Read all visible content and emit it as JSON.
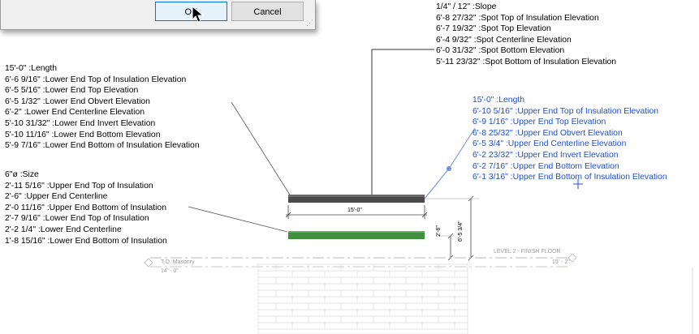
{
  "dialog": {
    "ok_label": "OK",
    "cancel_label": "Cancel"
  },
  "top_right_labels": [
    "1/4\" / 12\" :Slope",
    "6'-8 27/32\" :Spot Top of Insulation Elevation",
    "6'-7 19/32\" :Spot Top Elevation",
    "6'-4 9/32\" :Spot Centerline Elevation",
    "6'-0 31/32\" :Spot Bottom Elevation",
    "5'-11 23/32\" :Spot Bottom of Insulation Elevation"
  ],
  "lower_end_labels": [
    "15'-0\" :Length",
    "6'-6 9/16\" :Lower End Top of Insulation Elevation",
    "6'-5 5/16\" :Lower End Top Elevation",
    "6'-5 1/32\" :Lower End Obvert Elevation",
    "6'-2\" :Lower End Centerline Elevation",
    "5'-10 31/32\" :Lower End Invert Elevation",
    "5'-10 11/16\" :Lower End Bottom Elevation",
    "5'-9 7/16\" :Lower End Bottom of Insulation Elevation"
  ],
  "upper_end_labels": [
    "15'-0\" :Length",
    "6'-10 5/16\" :Upper End Top of Insulation Elevation",
    "6'-9 1/16\" :Upper End Top Elevation",
    "6'-8 25/32\" :Upper End Obvert Elevation",
    "6'-5 3/4\" :Upper End Centerline Elevation",
    "6'-2 23/32\" :Upper End Invert Elevation",
    "6'-2 7/16\" :Upper End Bottom Elevation",
    "6'-1 3/16\" :Upper End Bottom of Insulation Elevation"
  ],
  "size_labels": [
    "6\"ø :Size",
    "2'-11 5/16\" :Upper End Top of Insulation",
    "2'-6\" :Upper End Centerline",
    "2'-0 11/16\" :Upper End Bottom of Insulation",
    "2'-7 9/16\" :Lower End Top of Insulation",
    "2'-2 1/4\" :Lower End Centerline",
    "1'-8 15/16\" :Lower End Bottom of Insulation"
  ],
  "drawing": {
    "pipe_length_dim": "15'-0\"",
    "vertical_dim_1": "2'-6\"",
    "vertical_dim_2": "6'-5 3/4\"",
    "level_name": "LEVEL 2 - FINISH FLOOR",
    "level_elevation": "15' - 2\"",
    "masonry_name": "T.O. Masonry",
    "masonry_elevation": "14' - 0\""
  },
  "colors": {
    "pipe": "#4a4a4a",
    "insulation": "#3f8f3f",
    "selected_text": "#1f4fd1",
    "brick": "#d9d9d9"
  }
}
